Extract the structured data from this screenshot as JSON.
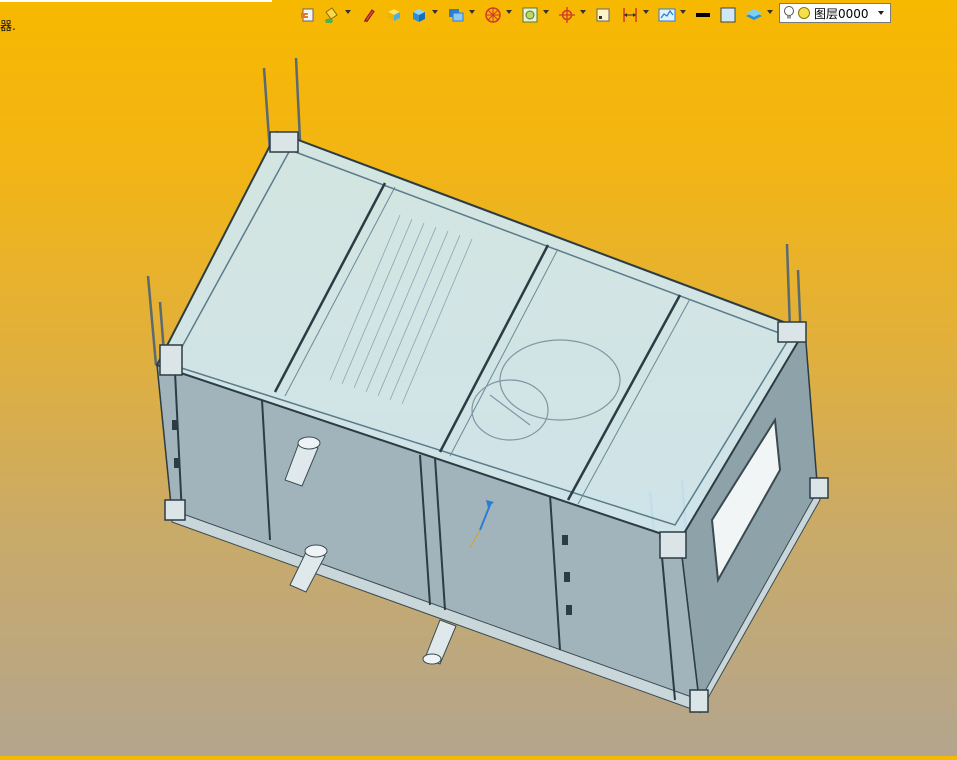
{
  "window": {
    "left_label": "器."
  },
  "toolbar": {
    "buttons": [
      {
        "name": "open-file-icon",
        "dropdown": false
      },
      {
        "name": "paint-bucket-icon",
        "dropdown": true
      },
      {
        "name": "pencil-sketch-icon",
        "dropdown": false
      },
      {
        "name": "solid-box-icon",
        "dropdown": false
      },
      {
        "name": "cube-view-icon",
        "dropdown": true
      },
      {
        "name": "shaded-display-icon",
        "dropdown": true
      },
      {
        "name": "wheel-tool-icon",
        "dropdown": true
      },
      {
        "name": "section-frame-icon",
        "dropdown": true
      },
      {
        "name": "target-crosshair-icon",
        "dropdown": true
      },
      {
        "name": "small-frame-icon",
        "dropdown": false
      },
      {
        "name": "dimension-icon",
        "dropdown": true
      },
      {
        "name": "chart-view-icon",
        "dropdown": true
      },
      {
        "name": "line-color-swatch",
        "dropdown": false
      },
      {
        "name": "fill-swatch",
        "dropdown": false
      },
      {
        "name": "layer-stack-icon",
        "dropdown": true
      }
    ],
    "colors": {
      "line_color": "#000000",
      "fill_color": "#cfe8f7",
      "accent": "#2a7fd4"
    }
  },
  "layer": {
    "current": "图层0000",
    "visible_icon": "lightbulb-icon",
    "state_icon": "yellow-circle-icon"
  },
  "viewport": {
    "background_top": "#f7b800",
    "background_bottom": "#b3a58e",
    "model_panel_color": "#9fb3bb",
    "model_glass_color": "#cfeaf7"
  }
}
